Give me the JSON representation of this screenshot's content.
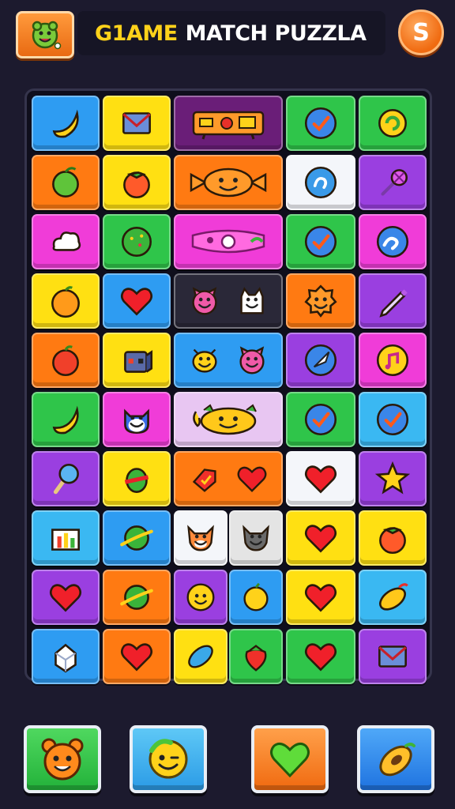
{
  "header": {
    "title_part1": "G1AME",
    "title_part2": "MATCH PUZZLA",
    "coin_glyph": "S",
    "avatar_icon": "green-creature-icon"
  },
  "colors": {
    "background": "#1c1a2e",
    "board": "#0f0e1c",
    "title_accent": "#ffd21a",
    "tile_blue": "#2e9cf2",
    "tile_yellow": "#ffe012",
    "tile_purple": "#9a3fe0",
    "tile_green": "#2fc54a",
    "tile_orange": "#ff7a12",
    "tile_magenta": "#f03cd8",
    "tile_white": "#f4f6fa"
  },
  "board": {
    "rows": [
      [
        "banana",
        "envelope",
        "radio-device",
        "check-badge",
        "swirl-creature"
      ],
      [
        "lime",
        "tomato",
        "candy-face",
        "swirl-badge",
        "flower-stick"
      ],
      [
        "cloud",
        "melon",
        "mask-creature",
        "check-badge",
        "wave-badge"
      ],
      [
        "orange",
        "heart",
        "pink-critter-and-ghost-cat",
        "cookie-face",
        "pencil"
      ],
      [
        "apple",
        "box-robot",
        "bee-and-pink-critter",
        "rocket-badge",
        "music-badge"
      ],
      [
        "banana",
        "cat-face",
        "fruit-face",
        "check-badge",
        "check-badge"
      ],
      [
        "ice-cream",
        "cactus-fruit",
        "tag-and-heart",
        "heart",
        "star"
      ],
      [
        "bar-chart",
        "planet",
        "fox-and-cat",
        "heart",
        "tomato"
      ],
      [
        "heart",
        "planet",
        "smiley-and-lemon",
        "heart",
        "mango"
      ],
      [
        "sugar-cube",
        "heart",
        "leaf-and-strawberry",
        "heart",
        "envelope"
      ]
    ]
  },
  "bottom_bar": {
    "buttons": [
      "orange-bear-icon",
      "winking-smiley-icon",
      "green-heart-icon",
      "papaya-icon"
    ]
  }
}
